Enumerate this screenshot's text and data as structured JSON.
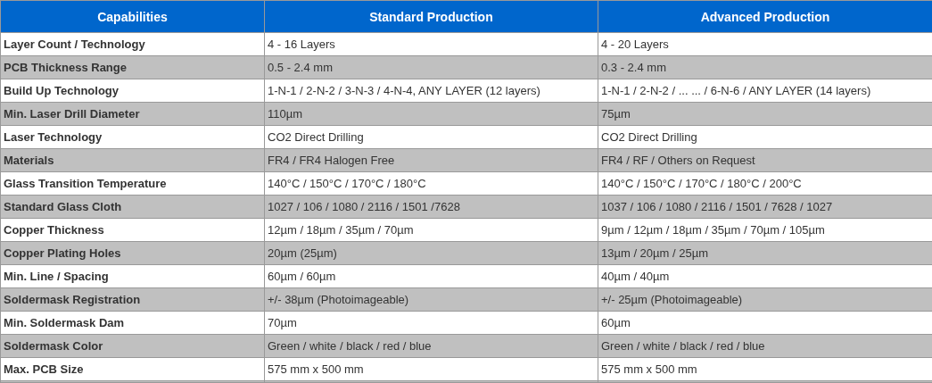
{
  "table": {
    "columns": [
      "Capabilities",
      "Standard Production",
      "Advanced Production"
    ],
    "rows": [
      [
        "Layer Count / Technology",
        "4 - 16 Layers",
        "4 - 20 Layers"
      ],
      [
        "PCB Thickness Range",
        "0.5 - 2.4 mm",
        "0.3 - 2.4 mm"
      ],
      [
        "Build Up Technology",
        "1-N-1 / 2-N-2 / 3-N-3 / 4-N-4, ANY LAYER (12 layers)",
        "1-N-1 / 2-N-2 / ... ... / 6-N-6 / ANY LAYER (14 layers)"
      ],
      [
        "Min. Laser Drill Diameter",
        "110µm",
        "75µm"
      ],
      [
        "Laser Technology",
        "CO2 Direct Drilling",
        "CO2 Direct Drilling"
      ],
      [
        "Materials",
        "FR4 / FR4 Halogen Free",
        "FR4 / RF / Others on Request"
      ],
      [
        "Glass Transition Temperature",
        "140°C / 150°C / 170°C / 180°C",
        "140°C / 150°C / 170°C / 180°C / 200°C"
      ],
      [
        "Standard Glass Cloth",
        "1027 / 106 / 1080 / 2116 / 1501 /7628",
        "1037 / 106 / 1080 / 2116 / 1501 / 7628 / 1027"
      ],
      [
        "Copper Thickness",
        "12µm / 18µm / 35µm / 70µm",
        "9µm / 12µm / 18µm / 35µm / 70µm / 105µm"
      ],
      [
        "Copper Plating Holes",
        "20µm (25µm)",
        "13µm / 20µm / 25µm"
      ],
      [
        "Min. Line / Spacing",
        "60µm / 60µm",
        "40µm / 40µm"
      ],
      [
        "Soldermask Registration",
        "+/- 38µm (Photoimageable)",
        "+/- 25µm (Photoimageable)"
      ],
      [
        "Min. Soldermask Dam",
        "70µm",
        "60µm"
      ],
      [
        "Soldermask Color",
        "Green / white / black / red / blue",
        "Green / white / black / red / blue"
      ],
      [
        "Max. PCB Size",
        "575 mm x 500 mm",
        "575 mm x 500 mm"
      ]
    ]
  }
}
